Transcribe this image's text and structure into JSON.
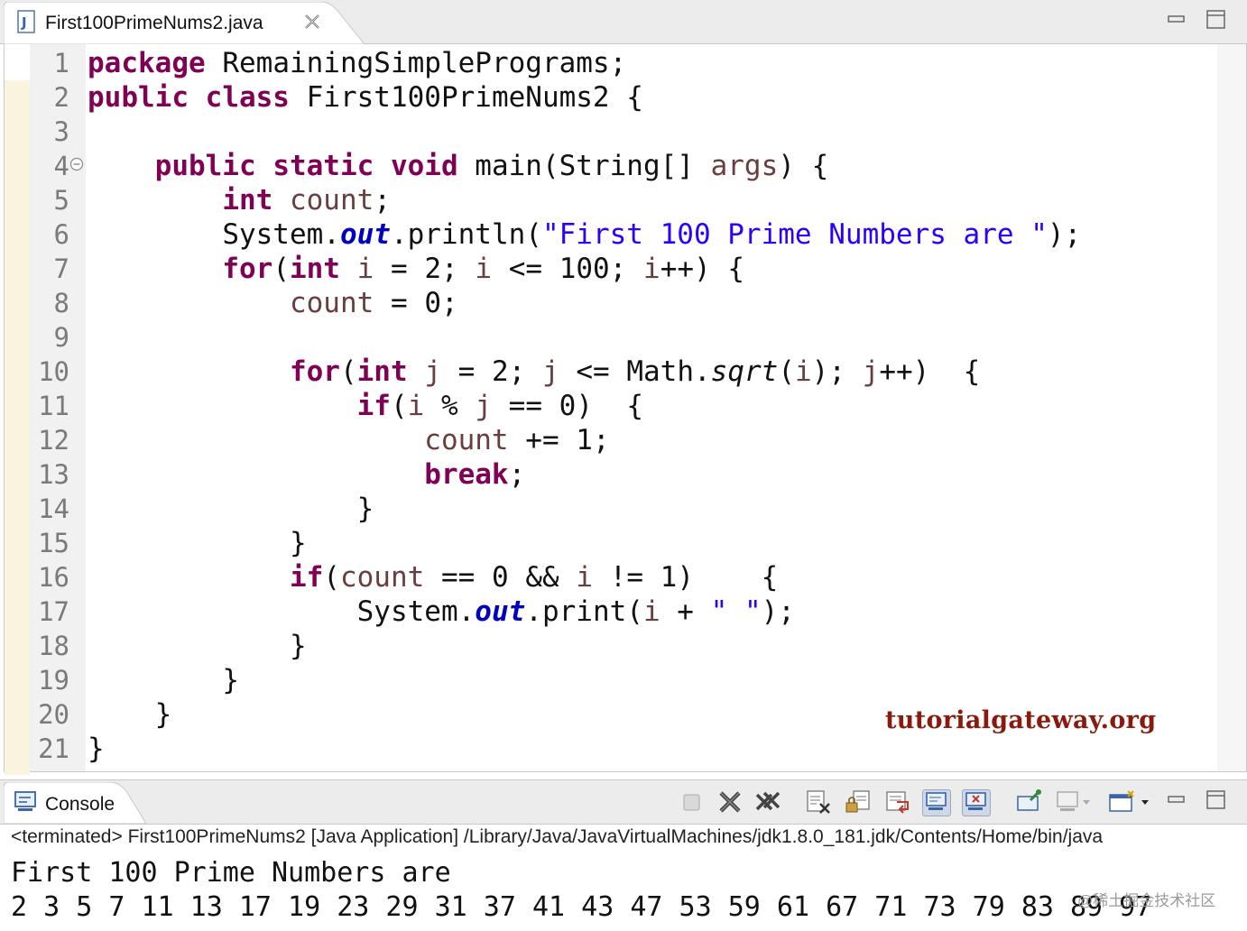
{
  "editor": {
    "tab_title": "First100PrimeNums2.java",
    "line_numbers": [
      "1",
      "2",
      "3",
      "4",
      "5",
      "6",
      "7",
      "8",
      "9",
      "10",
      "11",
      "12",
      "13",
      "14",
      "15",
      "16",
      "17",
      "18",
      "19",
      "20",
      "21"
    ],
    "code_lines": [
      "package RemainingSimplePrograms;",
      "public class First100PrimeNums2 {",
      "",
      "    public static void main(String[] args) {",
      "        int count;",
      "        System.out.println(\"First 100 Prime Numbers are \");",
      "        for(int i = 2; i <= 100; i++) {",
      "            count = 0;",
      "",
      "            for(int j = 2; j <= Math.sqrt(i); j++)  {",
      "                if(i % j == 0)  {",
      "                    count += 1;",
      "                    break;",
      "                }",
      "            }",
      "            if(count == 0 && i != 1)    {",
      "                System.out.print(i + \" \");",
      "            }",
      "        }",
      "    }",
      "}"
    ],
    "watermark": "tutorialgateway.org"
  },
  "console": {
    "tab_label": "Console",
    "status_line": "<terminated> First100PrimeNums2 [Java Application] /Library/Java/JavaVirtualMachines/jdk1.8.0_181.jdk/Contents/Home/bin/java",
    "output_lines": [
      "First 100 Prime Numbers are ",
      "2 3 5 7 11 13 17 19 23 29 31 37 41 43 47 53 59 61 67 71 73 79 83 89 97"
    ],
    "corner_mark": "@稀土掘金技术社区"
  },
  "colors": {
    "keyword": "#7f0055",
    "local_variable": "#6a3e3e",
    "string": "#2a00ff",
    "static_field": "#0000c0",
    "line_number": "#7a7a7a",
    "watermark": "#8b1a0e"
  },
  "icons": [
    "java-file-icon",
    "close-tab-icon",
    "minimize-icon",
    "maximize-icon",
    "fold-collapse-icon",
    "console-icon",
    "terminate-icon",
    "remove-launch-icon",
    "remove-all-launches-icon",
    "clear-console-icon",
    "scroll-lock-icon",
    "word-wrap-icon",
    "show-console-on-stdout-icon",
    "show-console-on-stderr-icon",
    "pin-console-icon",
    "display-selected-console-icon",
    "open-console-icon"
  ]
}
